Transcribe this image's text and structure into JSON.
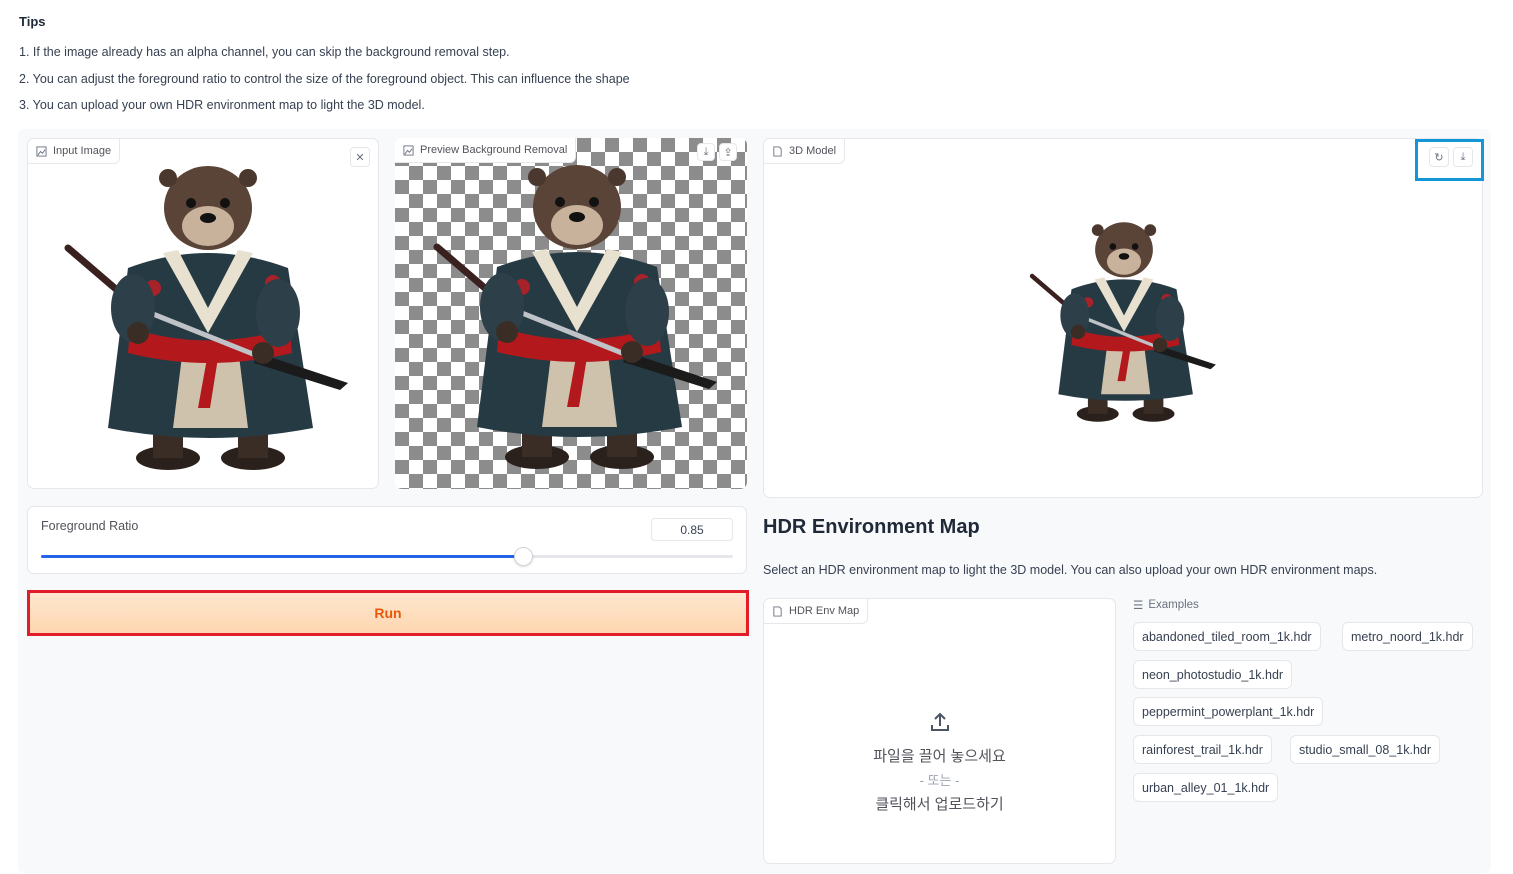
{
  "tips": {
    "heading": "Tips",
    "items": [
      "1. If the image already has an alpha channel, you can skip the background removal step.",
      "2. You can adjust the foreground ratio to control the size of the foreground object. This can influence the shape",
      "3. You can upload your own HDR environment map to light the 3D model."
    ]
  },
  "input_image": {
    "label": "Input Image",
    "clear_icon": "close-icon"
  },
  "preview": {
    "label": "Preview Background Removal",
    "download_icon": "download-icon",
    "share_icon": "share-icon"
  },
  "model3d": {
    "label": "3D Model",
    "reset_icon": "undo-icon",
    "download_icon": "download-icon"
  },
  "slider": {
    "label": "Foreground Ratio",
    "value": "0.85",
    "fraction": 0.696
  },
  "run": {
    "label": "Run"
  },
  "hdr": {
    "title": "HDR Environment Map",
    "description": "Select an HDR environment map to light the 3D model. You can also upload your own HDR environment maps.",
    "upload_label": "HDR Env Map",
    "upload_line1": "파일을 끌어 놓으세요",
    "upload_line2": "- 또는 -",
    "upload_line3": "클릭해서 업로드하기"
  },
  "examples": {
    "label": "Examples",
    "items": [
      "abandoned_tiled_room_1k.hdr",
      "metro_noord_1k.hdr",
      "neon_photostudio_1k.hdr",
      "peppermint_powerplant_1k.hdr",
      "rainforest_trail_1k.hdr",
      "studio_small_08_1k.hdr",
      "urban_alley_01_1k.hdr"
    ]
  },
  "colors": {
    "accent_blue": "#2563eb",
    "run_text": "#ea580c",
    "run_border": "#e11d2a",
    "highlight": "#1396d8"
  }
}
